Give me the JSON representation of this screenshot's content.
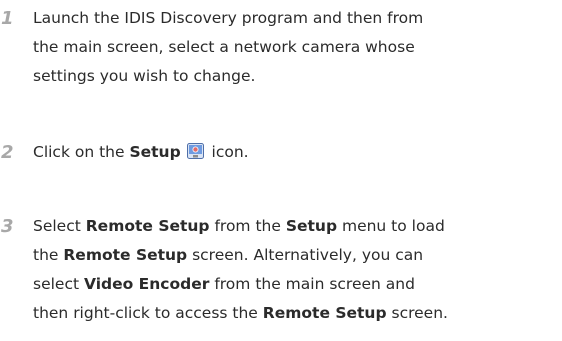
{
  "steps": [
    {
      "number": "1",
      "lines": [
        "Launch the IDIS Discovery program and then from",
        "the main screen, select a network camera whose",
        "settings you wish to change."
      ]
    },
    {
      "number": "2",
      "text_before": "Click on the ",
      "bold_setup": "Setup",
      "text_after": " icon.",
      "icon": "setup-icon"
    },
    {
      "number": "3",
      "line1": {
        "t1": "Select ",
        "b1": "Remote Setup",
        "t2": " from the ",
        "b2": "Setup",
        "t3": " menu to load"
      },
      "line2": {
        "t1": "the ",
        "b1": "Remote Setup",
        "t2": " screen. Alternatively, you can"
      },
      "line3": {
        "t1": "select ",
        "b1": "Video Encoder",
        "t2": " from the main screen and"
      },
      "line4": {
        "t1": "then right-click to access the ",
        "b1": "Remote Setup",
        "t2": " screen."
      }
    }
  ]
}
